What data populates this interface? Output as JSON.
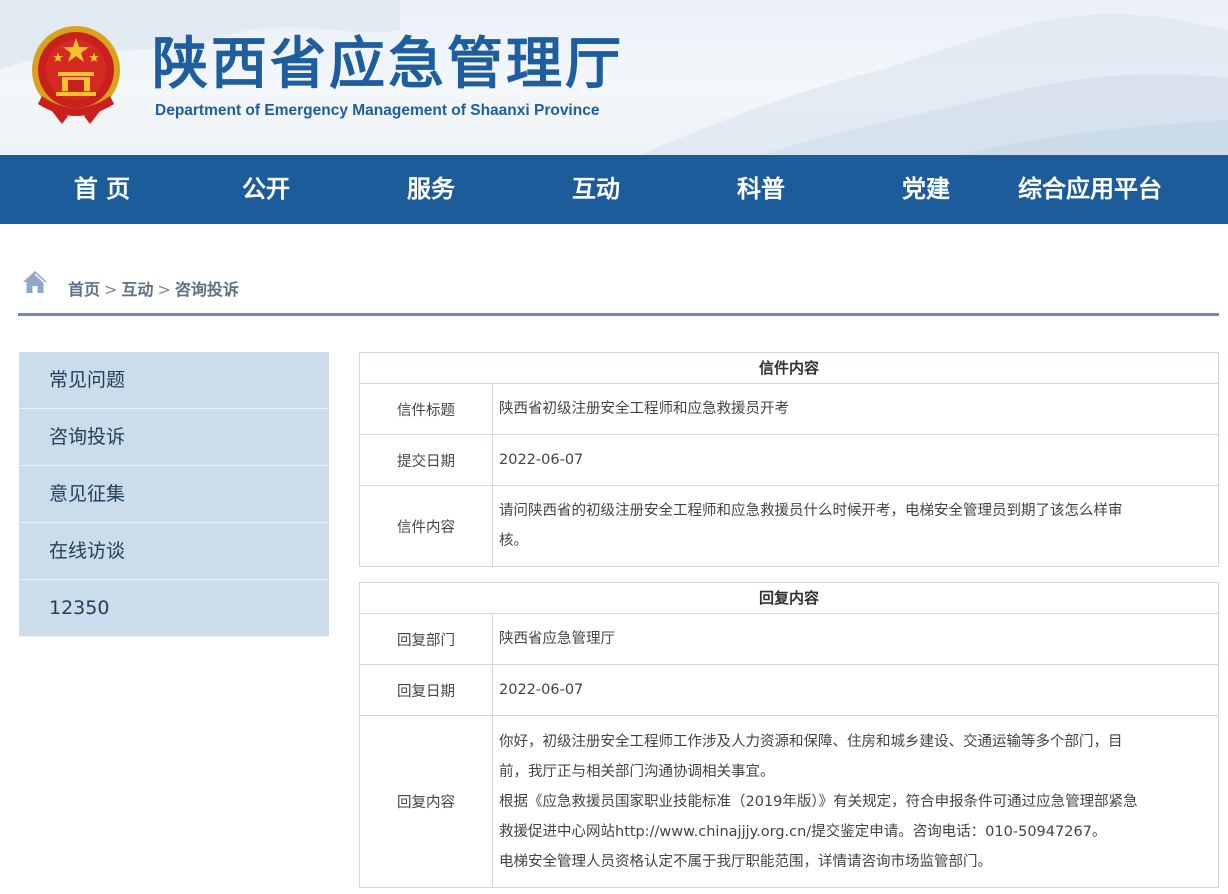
{
  "header": {
    "title": "陕西省应急管理厅",
    "subtitle": "Department of Emergency Management of Shaanxi Province"
  },
  "nav": {
    "items": [
      "首 页",
      "公开",
      "服务",
      "互动",
      "科普",
      "党建",
      "综合应用平台"
    ]
  },
  "breadcrumb": {
    "home": "首页",
    "level1": "互动",
    "level2": "咨询投诉",
    "separator": ">"
  },
  "sidebar": {
    "items": [
      "常见问题",
      "咨询投诉",
      "意见征集",
      "在线访谈",
      "12350"
    ]
  },
  "letter": {
    "heading": "信件内容",
    "title_label": "信件标题",
    "title_value": "陕西省初级注册安全工程师和应急救援员开考",
    "date_label": "提交日期",
    "date_value": "2022-06-07",
    "content_label": "信件内容",
    "content_lines": [
      "请问陕西省的初级注册安全工程师和应急救援员什么时候开考，电梯安全管理员到期了该怎么样审",
      "核。"
    ]
  },
  "reply": {
    "heading": "回复内容",
    "dept_label": "回复部门",
    "dept_value": "陕西省应急管理厅",
    "date_label": "回复日期",
    "date_value": "2022-06-07",
    "content_label": "回复内容",
    "content_lines": [
      "你好，初级注册安全工程师工作涉及人力资源和保障、住房和城乡建设、交通运输等多个部门，目",
      "前，我厅正与相关部门沟通协调相关事宜。",
      "根据《应急救援员国家职业技能标准（2019年版）》有关规定，符合申报条件可通过应急管理部紧急",
      "救援促进中心网站http://www.chinajjjy.org.cn/提交鉴定申请。咨询电话：010-50947267。",
      "电梯安全管理人员资格认定不属于我厅职能范围，详情请咨询市场监管部门。"
    ]
  },
  "colors": {
    "brand_blue": "#1d5c9b",
    "title_blue": "#1e5e9e",
    "sidebar_bg": "#cbdcea",
    "border": "#d2d8de"
  },
  "icons": {
    "emblem": "national-emblem-icon",
    "home": "home-icon"
  }
}
